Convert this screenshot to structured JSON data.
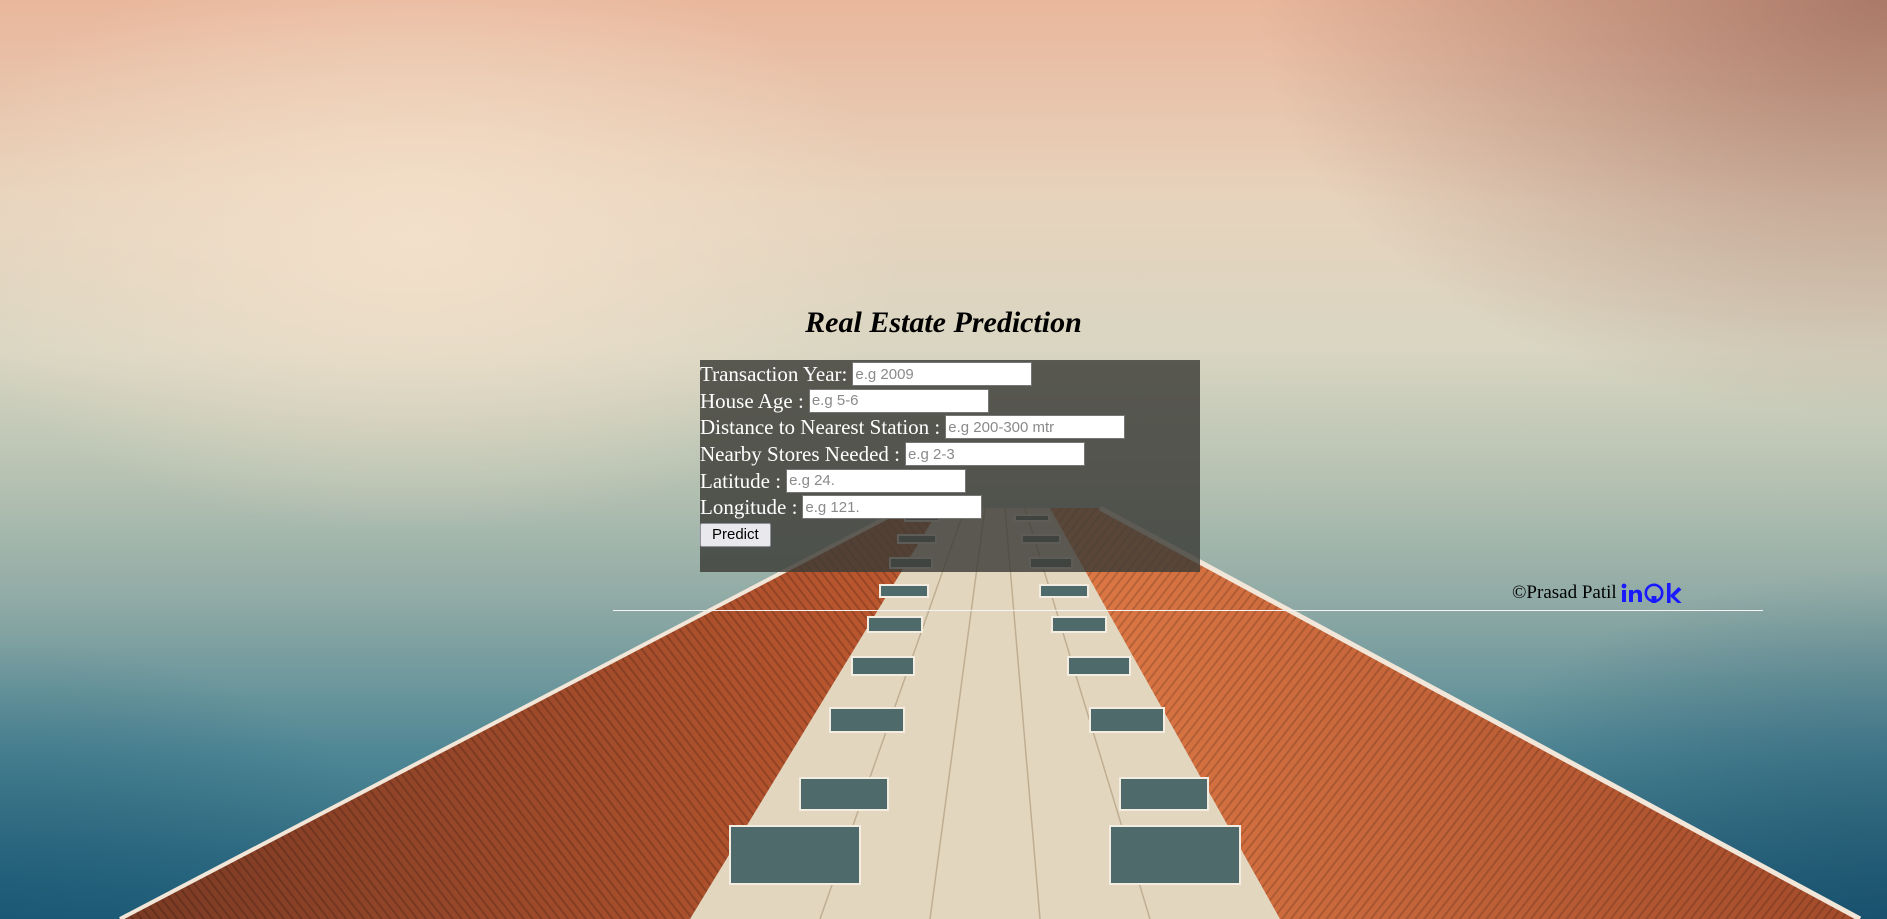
{
  "page": {
    "title": "Real Estate Prediction"
  },
  "form": {
    "fields": [
      {
        "label": "Transaction Year:",
        "placeholder": "e.g 2009",
        "value": ""
      },
      {
        "label": "House Age :",
        "placeholder": "e.g 5-6",
        "value": ""
      },
      {
        "label": "Distance to Nearest Station :",
        "placeholder": "e.g 200-300 mtr",
        "value": ""
      },
      {
        "label": "Nearby Stores Needed :",
        "placeholder": "e.g 2-3",
        "value": ""
      },
      {
        "label": "Latitude :",
        "placeholder": "e.g 24.",
        "value": ""
      },
      {
        "label": "Longitude :",
        "placeholder": "e.g 121.",
        "value": ""
      }
    ],
    "submit_label": "Predict"
  },
  "footer": {
    "credit": "©Prasad Patil",
    "icons": [
      "linkedin-icon",
      "github-icon",
      "kaggle-icon"
    ],
    "icon_color": "#1a1aff"
  },
  "colors": {
    "form_background": "#3c3c37",
    "divider": "#f4f4f4"
  }
}
